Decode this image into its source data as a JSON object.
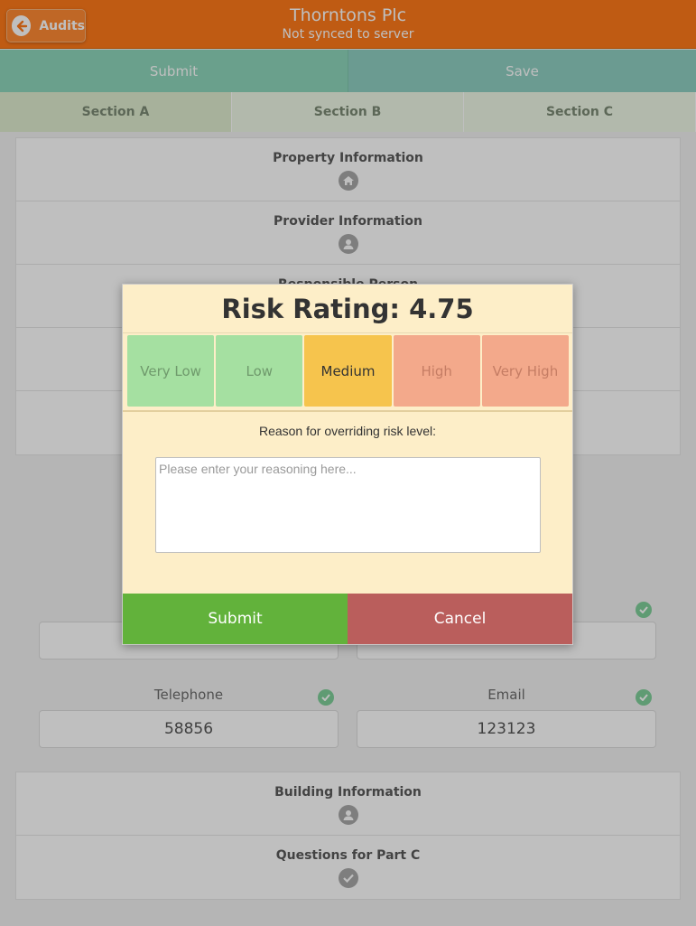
{
  "header": {
    "back_label": "Audits",
    "title": "Thorntons Plc",
    "subtitle": "Not synced to server"
  },
  "actions": {
    "submit_label": "Submit",
    "save_label": "Save"
  },
  "tabs": [
    {
      "label": "Section A",
      "active": true
    },
    {
      "label": "Section B",
      "active": false
    },
    {
      "label": "Section C",
      "active": false
    }
  ],
  "sections_top": [
    {
      "label": "Property Information",
      "icon": "home-icon"
    },
    {
      "label": "Provider Information",
      "icon": "user-icon"
    },
    {
      "label": "Responsible Person",
      "icon": "user-icon"
    },
    {
      "label": "",
      "icon": ""
    },
    {
      "label": "",
      "icon": ""
    }
  ],
  "fields": {
    "telephone": {
      "label": "Telephone",
      "value": "58856"
    },
    "email": {
      "label": "Email",
      "value": "123123"
    }
  },
  "sections_bottom": [
    {
      "label": "Building Information",
      "icon": "user-icon"
    },
    {
      "label": "Questions for Part C",
      "icon": "check-icon"
    }
  ],
  "modal": {
    "title": "Risk Rating: 4.75",
    "ratings": [
      {
        "label": "Very Low"
      },
      {
        "label": "Low"
      },
      {
        "label": "Medium"
      },
      {
        "label": "High"
      },
      {
        "label": "Very High"
      }
    ],
    "selected_rating": "Medium",
    "reason_label": "Reason for overriding risk level:",
    "reason_placeholder": "Please enter your reasoning here...",
    "submit_label": "Submit",
    "cancel_label": "Cancel"
  },
  "colors": {
    "header": "#ff7a1a",
    "submit_green": "#62b23b",
    "cancel_red": "#ba5e5c",
    "medium": "#f6c44d"
  }
}
